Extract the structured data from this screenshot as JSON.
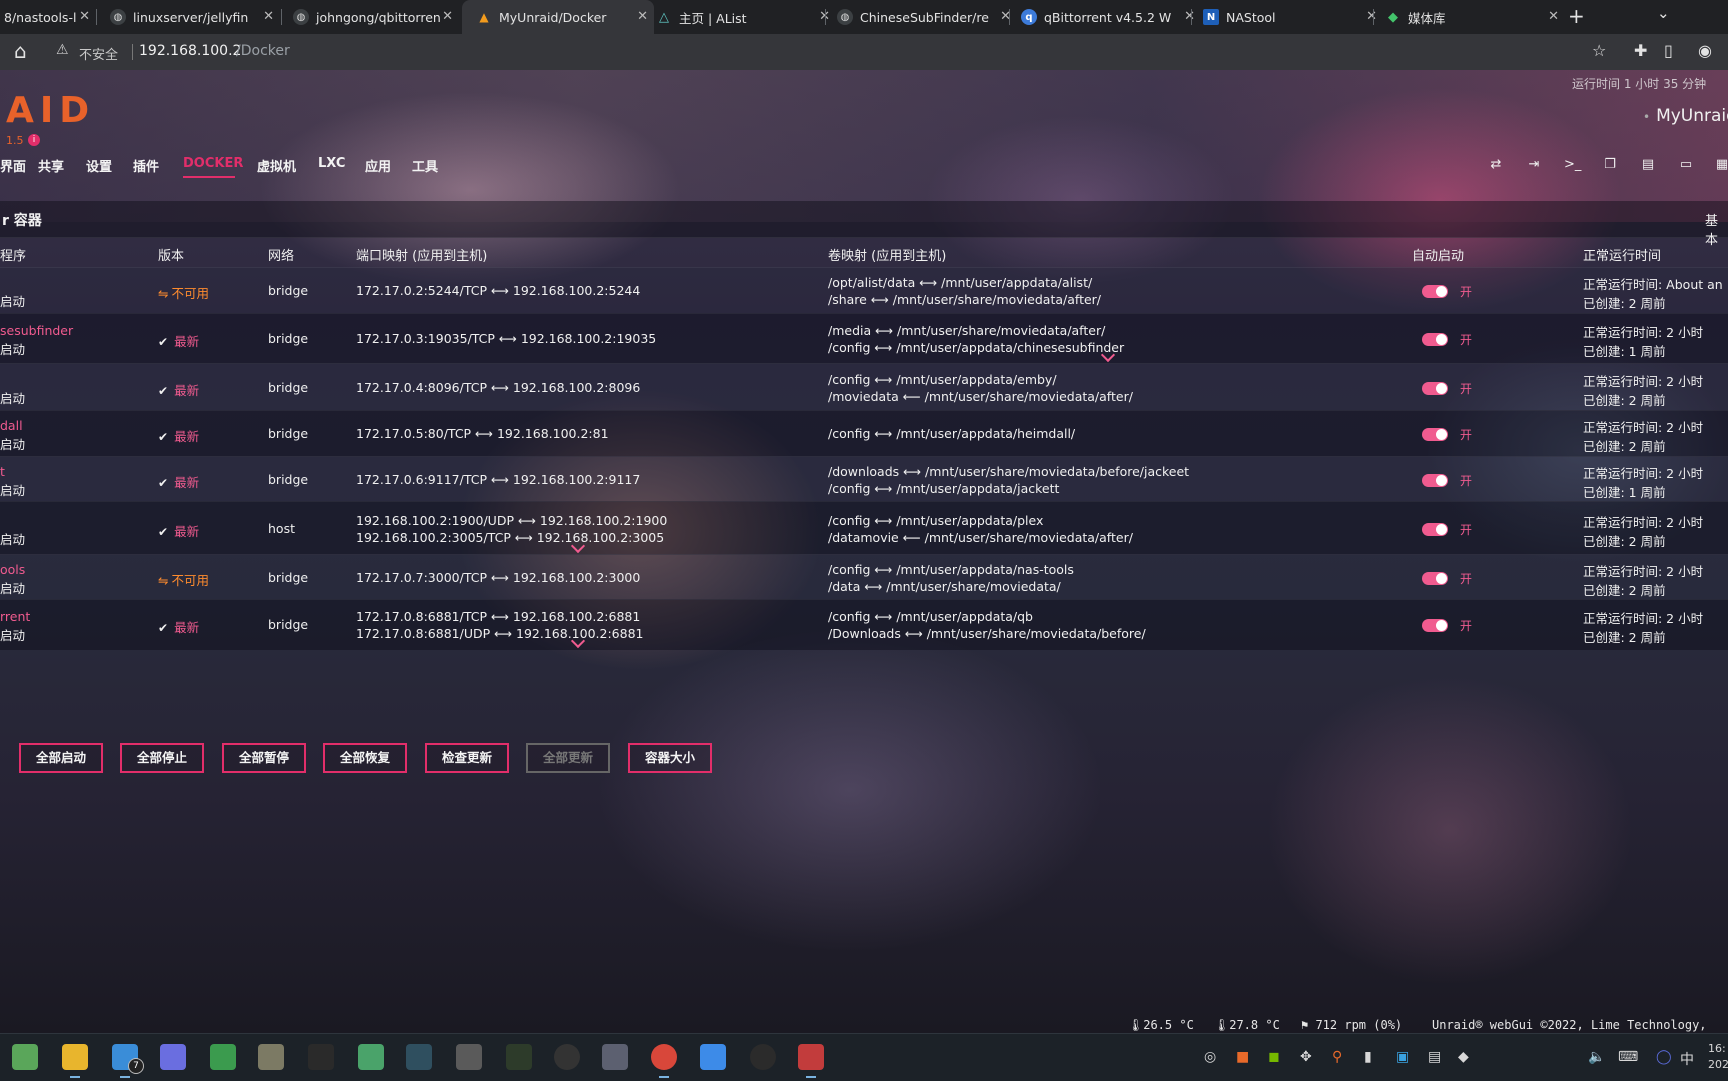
{
  "browser": {
    "tabs": [
      {
        "title": "8/nastools-l",
        "icon_color": "#3c4043"
      },
      {
        "title": "linuxserver/jellyfin",
        "icon_color": "#3c4043"
      },
      {
        "title": "johngong/qbittorren",
        "icon_color": "#3c4043"
      },
      {
        "title": "MyUnraid/Docker",
        "icon_color": "#f29b1d"
      },
      {
        "title": "主页 | AList",
        "icon_color": "#5ec4c0"
      },
      {
        "title": "ChineseSubFinder/re",
        "icon_color": "#3c4043"
      },
      {
        "title": "qBittorrent v4.5.2 W",
        "icon_color": "#3d7bd9"
      },
      {
        "title": "NAStool",
        "icon_color": "#1e5fb8"
      },
      {
        "title": "媒体库",
        "icon_color": "#43c36b"
      }
    ],
    "new_tab": "+",
    "window_control": "⌄",
    "address": {
      "security_label": "不安全",
      "host": "192.168.100.2",
      "path": "/Docker"
    }
  },
  "header": {
    "logo": "AID",
    "version": "1.5",
    "uptime": "运行时间 1 小时 35 分钟",
    "server_name": "MyUnraid",
    "nav": [
      {
        "label": "界面",
        "active": false
      },
      {
        "label": "共享",
        "active": false
      },
      {
        "label": "设置",
        "active": false
      },
      {
        "label": "插件",
        "active": false
      },
      {
        "label": "DOCKER",
        "active": true
      },
      {
        "label": "虚拟机",
        "active": false
      },
      {
        "label": "LXC",
        "active": false
      },
      {
        "label": "应用",
        "active": false
      },
      {
        "label": "工具",
        "active": false
      }
    ],
    "icons": [
      "loop-icon",
      "logout-icon",
      "terminal-icon",
      "copy-icon",
      "feedback-icon",
      "monitor-icon",
      "more-icon"
    ]
  },
  "section": {
    "title": "r 容器",
    "right_label": "基本"
  },
  "table": {
    "headers": {
      "app": "程序",
      "version": "版本",
      "network": "网络",
      "ports": "端口映射 (应用到主机)",
      "volumes": "卷映射 (应用到主机)",
      "autostart": "自动启动",
      "uptime": "正常运行时间"
    },
    "rows": [
      {
        "name": "",
        "status": "启动",
        "version": "不可用",
        "version_ok": false,
        "network": "bridge",
        "ports": [
          "172.17.0.2:5244/TCP ⟷ 192.168.100.2:5244"
        ],
        "volumes": [
          "/opt/alist/data ⟷ /mnt/user/appdata/alist/",
          "/share ⟷ /mnt/user/share/moviedata/after/"
        ],
        "autostart": "开",
        "uptime": "正常运行时间: About an ",
        "created": "已创建: 2 周前"
      },
      {
        "name": "sesubfinder",
        "status": "启动",
        "version": "最新",
        "version_ok": true,
        "network": "bridge",
        "ports": [
          "172.17.0.3:19035/TCP ⟷ 192.168.100.2:19035"
        ],
        "volumes": [
          "/media ⟷ /mnt/user/share/moviedata/after/",
          "/config ⟷ /mnt/user/appdata/chinesesubfinder"
        ],
        "autostart": "开",
        "uptime": "正常运行时间: 2 小时",
        "created": "已创建: 1 周前"
      },
      {
        "name": "",
        "status": "启动",
        "version": "最新",
        "version_ok": true,
        "network": "bridge",
        "ports": [
          "172.17.0.4:8096/TCP ⟷ 192.168.100.2:8096"
        ],
        "volumes": [
          "/config ⟷ /mnt/user/appdata/emby/",
          "/moviedata ⟵ /mnt/user/share/moviedata/after/"
        ],
        "autostart": "开",
        "uptime": "正常运行时间: 2 小时",
        "created": "已创建: 2 周前"
      },
      {
        "name": "dall",
        "status": "启动",
        "version": "最新",
        "version_ok": true,
        "network": "bridge",
        "ports": [
          "172.17.0.5:80/TCP ⟷ 192.168.100.2:81"
        ],
        "volumes": [
          "/config ⟷ /mnt/user/appdata/heimdall/"
        ],
        "autostart": "开",
        "uptime": "正常运行时间: 2 小时",
        "created": "已创建: 2 周前"
      },
      {
        "name": "t",
        "status": "启动",
        "version": "最新",
        "version_ok": true,
        "network": "bridge",
        "ports": [
          "172.17.0.6:9117/TCP ⟷ 192.168.100.2:9117"
        ],
        "volumes": [
          "/downloads ⟷ /mnt/user/share/moviedata/before/jackeet",
          "/config ⟷ /mnt/user/appdata/jackett"
        ],
        "autostart": "开",
        "uptime": "正常运行时间: 2 小时",
        "created": "已创建: 1 周前"
      },
      {
        "name": "",
        "status": "启动",
        "version": "最新",
        "version_ok": true,
        "network": "host",
        "ports": [
          "192.168.100.2:1900/UDP ⟷ 192.168.100.2:1900",
          "192.168.100.2:3005/TCP ⟷ 192.168.100.2:3005"
        ],
        "volumes": [
          "/config ⟷ /mnt/user/appdata/plex",
          "/datamovie ⟵ /mnt/user/share/moviedata/after/"
        ],
        "autostart": "开",
        "uptime": "正常运行时间: 2 小时",
        "created": "已创建: 2 周前"
      },
      {
        "name": "ools",
        "status": "启动",
        "version": "不可用",
        "version_ok": false,
        "network": "bridge",
        "ports": [
          "172.17.0.7:3000/TCP ⟷ 192.168.100.2:3000"
        ],
        "volumes": [
          "/config ⟷ /mnt/user/appdata/nas-tools",
          "/data ⟷ /mnt/user/share/moviedata/"
        ],
        "autostart": "开",
        "uptime": "正常运行时间: 2 小时",
        "created": "已创建: 2 周前"
      },
      {
        "name": "rrent",
        "status": "启动",
        "version": "最新",
        "version_ok": true,
        "network": "bridge",
        "ports": [
          "172.17.0.8:6881/TCP ⟷ 192.168.100.2:6881",
          "172.17.0.8:6881/UDP ⟷ 192.168.100.2:6881"
        ],
        "volumes": [
          "/config ⟷ /mnt/user/appdata/qb",
          "/Downloads ⟷ /mnt/user/share/moviedata/before/"
        ],
        "autostart": "开",
        "uptime": "正常运行时间: 2 小时",
        "created": "已创建: 2 周前"
      }
    ]
  },
  "buttons": [
    {
      "label": "全部启动",
      "enabled": true
    },
    {
      "label": "全部停止",
      "enabled": true
    },
    {
      "label": "全部暂停",
      "enabled": true
    },
    {
      "label": "全部恢复",
      "enabled": true
    },
    {
      "label": "检查更新",
      "enabled": true
    },
    {
      "label": "全部更新",
      "enabled": false
    },
    {
      "label": "容器大小",
      "enabled": true
    }
  ],
  "footer": {
    "temp1": "26.5 °C",
    "temp2": "27.8 °C",
    "fan": "712 rpm (0%)",
    "copyright": "Unraid® webGui ©2022, Lime Technology,"
  },
  "taskbar": {
    "mail_badge": "7",
    "ime": "中",
    "clock": "16:",
    "date": "202"
  },
  "colors": {
    "accent": "#e22e6a",
    "logo": "#e8622a",
    "warning": "#ff8c2e"
  }
}
